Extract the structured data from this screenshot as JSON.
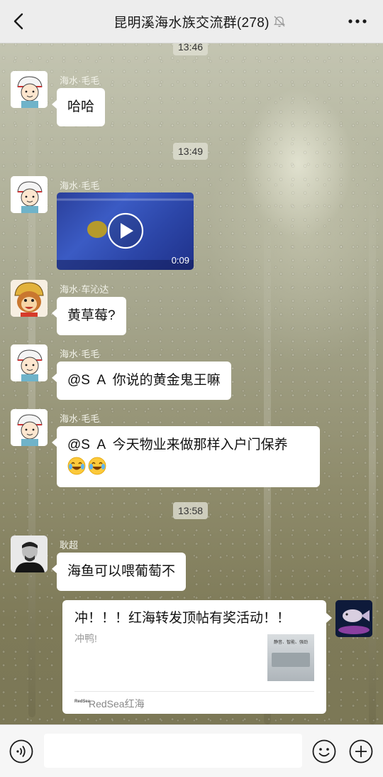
{
  "header": {
    "title": "昆明溪海水族交流群(278)",
    "back_icon": "chevron-left-icon",
    "mute_icon": "bell-off-icon",
    "more_icon": "ellipsis-icon"
  },
  "messages": [
    {
      "type": "time",
      "text": "13:46"
    },
    {
      "type": "text",
      "sender": "海水·毛毛",
      "text": "哈哈"
    },
    {
      "type": "time",
      "text": "13:49"
    },
    {
      "type": "video",
      "sender": "海水·毛毛",
      "duration": "0:09"
    },
    {
      "type": "text",
      "sender": "海水·车沁达",
      "text": "黄草莓?"
    },
    {
      "type": "text",
      "sender": "海水·毛毛",
      "text": "@S  A  你说的黄金鬼王嘛"
    },
    {
      "type": "text",
      "sender": "海水·毛毛",
      "text": "@S  A  今天物业来做那样入户门保养",
      "emoji": [
        "face-with-tears-of-joy",
        "face-with-tears-of-joy"
      ]
    },
    {
      "type": "time",
      "text": "13:58"
    },
    {
      "type": "text",
      "sender": "耿超",
      "text": "海鱼可以喂葡萄不"
    },
    {
      "type": "link",
      "from_self": true,
      "title": "冲！！！红海转发顶帖有奖活动！！",
      "desc": "冲鸭!",
      "source": "RedSea红海",
      "source_logo_text": "RedSea",
      "thumb_text": "静音、智能、强劲"
    }
  ],
  "input_bar": {
    "voice_icon": "voice-icon",
    "emoji_icon": "smiley-icon",
    "plus_icon": "plus-circle-icon",
    "placeholder": ""
  },
  "colors": {
    "header_bg": "#ededed",
    "bubble_bg": "#ffffff",
    "sender_name": "#f3f3ea",
    "input_bar_bg": "#f6f6f6"
  }
}
